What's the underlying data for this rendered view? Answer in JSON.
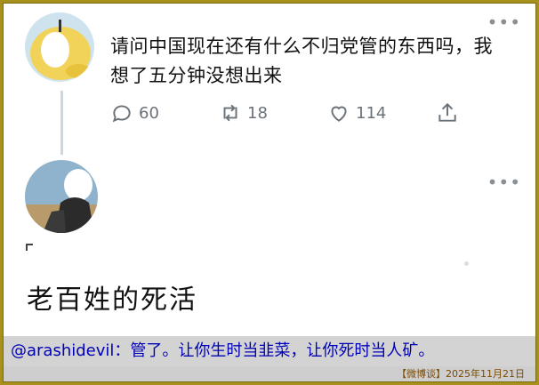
{
  "tweet1": {
    "text": "请问中国现在还有什么不归党管的东西吗，我想了五分钟没想出来",
    "more_label": "•••",
    "reply_count": "60",
    "retweet_count": "18",
    "like_count": "114"
  },
  "tweet2": {
    "more_label": "•••",
    "text": "老百姓的死活"
  },
  "caption": {
    "text": "@arashidevil：管了。让你生时当韭菜，让你死时当人矿。"
  },
  "source": {
    "text": "【微博谈】2025年11月21日"
  },
  "colors": {
    "frame_border": "#a8901c",
    "caption_bg": "#d3d3d3",
    "caption_text": "#0000b8",
    "source_text": "#7a4a00"
  }
}
